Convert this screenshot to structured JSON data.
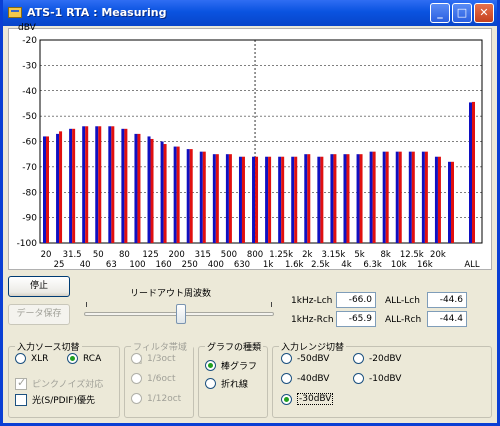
{
  "window": {
    "title": "ATS-1 RTA : Measuring",
    "buttons": {
      "minimize": "_",
      "maximize": "□",
      "close": "✕"
    }
  },
  "chart_data": {
    "type": "bar",
    "ylabel": "dBV",
    "ylim": [
      -100,
      -20
    ],
    "yticks": [
      -20,
      -30,
      -40,
      -50,
      -60,
      -70,
      -80,
      -90,
      -100
    ],
    "grid": true,
    "categories_upper": [
      "20",
      "31.5",
      "50",
      "80",
      "125",
      "200",
      "315",
      "500",
      "800",
      "1.25k",
      "2k",
      "3.15k",
      "5k",
      "8k",
      "12.5k",
      "20k"
    ],
    "categories_lower": [
      "25",
      "40",
      "63",
      "100",
      "160",
      "250",
      "400",
      "630",
      "1k",
      "1.6k",
      "2.5k",
      "4k",
      "6.3k",
      "10k",
      "16k"
    ],
    "all_label": "ALL",
    "series": [
      {
        "color": "#1010c0",
        "values": [
          -58,
          -57,
          -55,
          -54,
          -54,
          -54,
          -55,
          -57,
          -58,
          -60,
          -62,
          -63,
          -64,
          -65,
          -65,
          -66,
          -66,
          -66,
          -66,
          -66,
          -65,
          -66,
          -65,
          -65,
          -65,
          -64,
          -64,
          -64,
          -64,
          -64,
          -66,
          -68,
          -44.6
        ]
      },
      {
        "color": "#e01010",
        "values": [
          -58,
          -56,
          -55,
          -54,
          -54,
          -54,
          -55,
          -57,
          -59,
          -61,
          -62,
          -63,
          -64,
          -65,
          -65,
          -66,
          -66,
          -66,
          -66,
          -66,
          -65,
          -66,
          -65,
          -65,
          -65,
          -64,
          -64,
          -64,
          -64,
          -64,
          -66,
          -68,
          -44.4
        ]
      }
    ]
  },
  "controls": {
    "stop_button": "停止",
    "save_button": "データ保存",
    "readout_slider_label": "リードアウト周波数"
  },
  "readouts": {
    "k1_l_label": "1kHz-Lch",
    "k1_l_value": "-66.0",
    "k1_r_label": "1kHz-Rch",
    "k1_r_value": "-65.9",
    "all_l_label": "ALL-Lch",
    "all_l_value": "-44.6",
    "all_r_label": "ALL-Rch",
    "all_r_value": "-44.4"
  },
  "input_source": {
    "title": "入力ソース切替",
    "xlr": "XLR",
    "rca": "RCA",
    "pink": "ピンクノイズ対応",
    "optical": "光(S/PDIF)優先"
  },
  "filter": {
    "title": "フィルタ帯域幅",
    "opt1": "1/3oct",
    "opt2": "1/6oct",
    "opt3": "1/12oct"
  },
  "graph_type": {
    "title": "グラフの種類",
    "bar": "棒グラフ",
    "line": "折れ線"
  },
  "range": {
    "title": "入力レンジ切替",
    "m50": "-50dBV",
    "m20": "-20dBV",
    "m40": "-40dBV",
    "m10": "-10dBV",
    "m30": "-30dBV"
  }
}
